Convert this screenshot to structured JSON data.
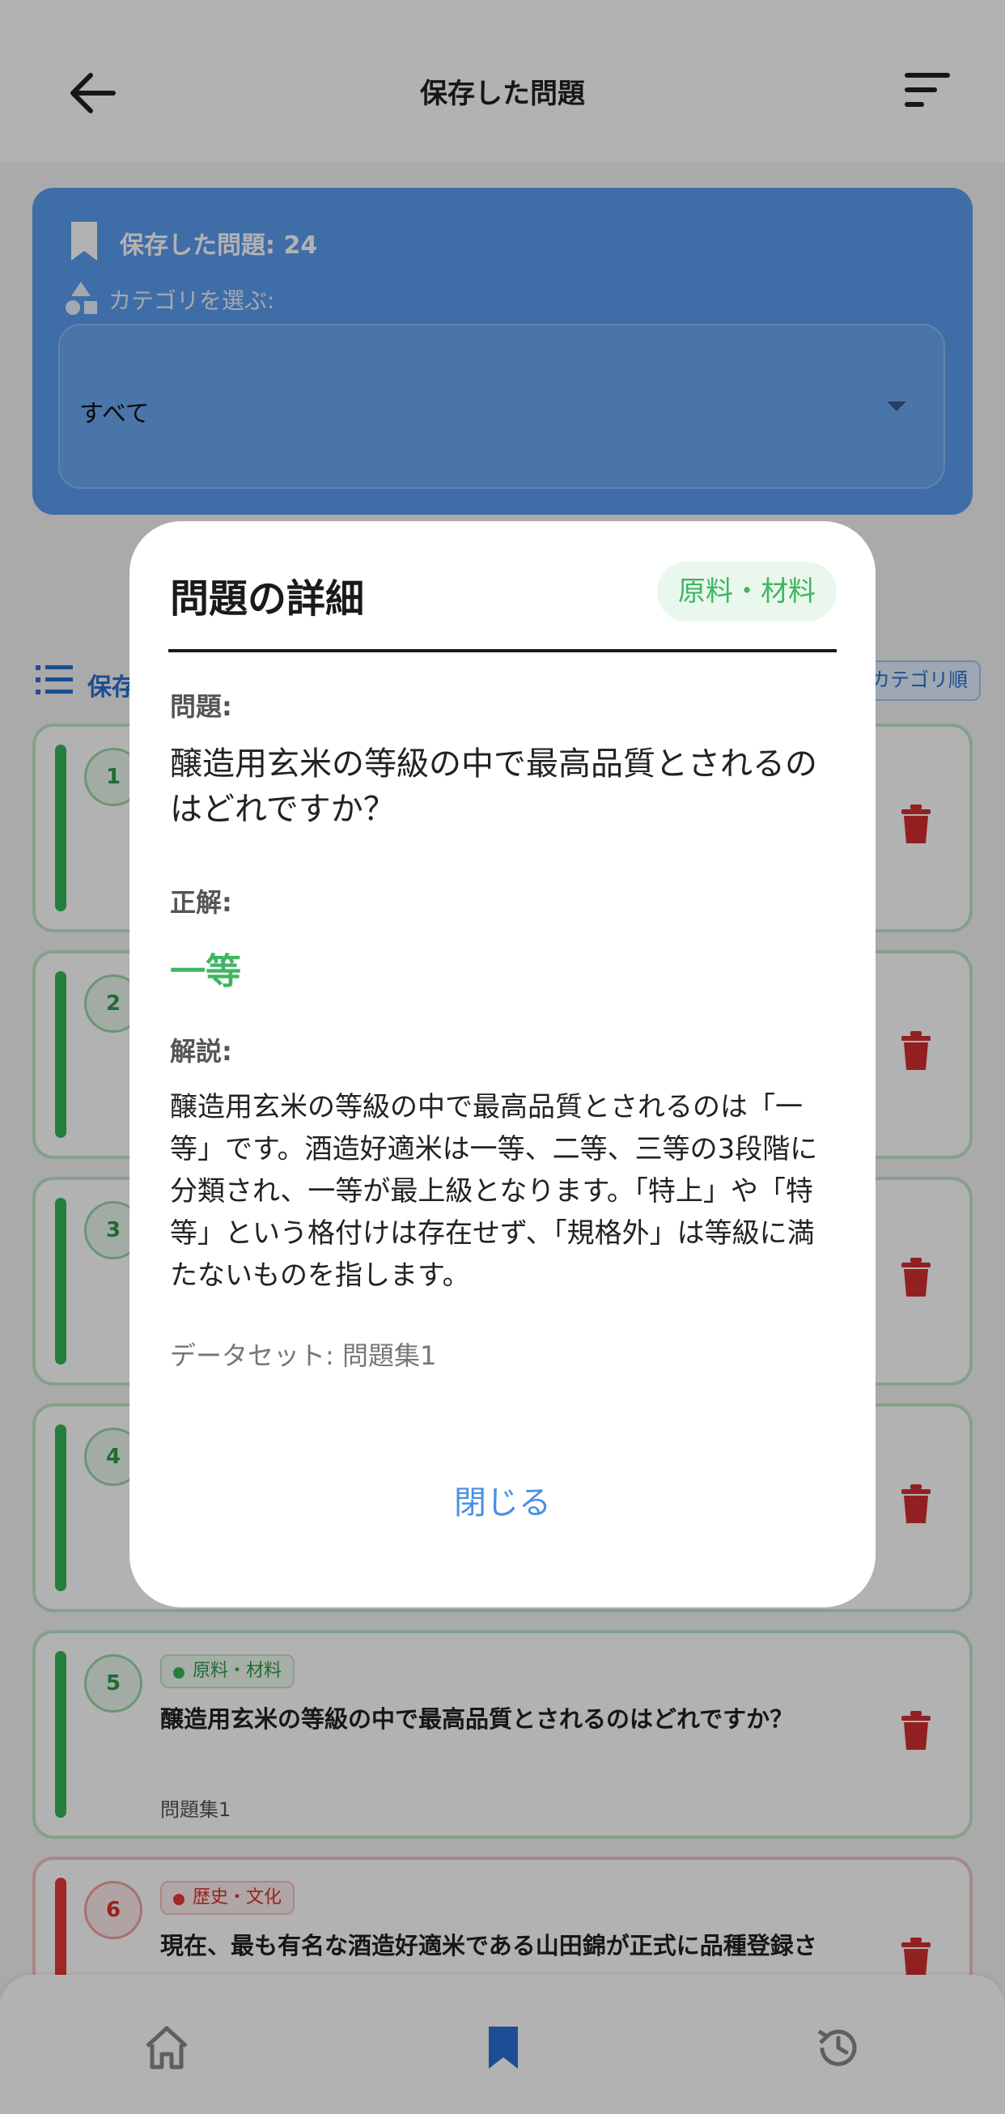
{
  "appbar": {
    "title": "保存した問題"
  },
  "summary": {
    "count_label": "保存した問題: 24",
    "category_label": "カテゴリを選ぶ:",
    "selected_category": "すべて"
  },
  "list": {
    "header": "保存",
    "sort_chip": "カテゴリ順"
  },
  "cards": [
    {
      "num": "1"
    },
    {
      "num": "2"
    },
    {
      "num": "3"
    },
    {
      "num": "4"
    },
    {
      "num": "5",
      "category": "原料・材料",
      "text": "醸造用玄米の等級の中で最高品質とされるのはどれですか？",
      "dataset": "問題集1"
    },
    {
      "num": "6",
      "category": "歴史・文化",
      "text": "現在、最も有名な酒造好適米である山田錦が正式に品種登録さ"
    }
  ],
  "modal": {
    "title": "問題の詳細",
    "category": "原料・材料",
    "question_label": "問題:",
    "question": "醸造用玄米の等級の中で最高品質とされるのはどれですか？",
    "answer_label": "正解:",
    "answer": "一等",
    "explanation_label": "解説:",
    "explanation": "醸造用玄米の等級の中で最高品質とされるのは「一等」です。酒造好適米は一等、二等、三等の3段階に分類され、一等が最上級となります。「特上」や「特等」という格付けは存在せず、「規格外」は等級に満たないものを指します。",
    "dataset": "データセット: 問題集1",
    "close": "閉じる"
  },
  "icons": {
    "back": "arrow-left-icon",
    "sort": "sort-lines-icon",
    "bookmark": "bookmark-icon",
    "shapes": "shapes-icon",
    "list": "list-icon",
    "trash": "trash-icon",
    "home": "home-icon",
    "history": "history-icon"
  },
  "colors": {
    "primary": "#4a90e2",
    "green": "#3fb562",
    "red": "#e53935",
    "card_blue": "#5b9df0"
  }
}
